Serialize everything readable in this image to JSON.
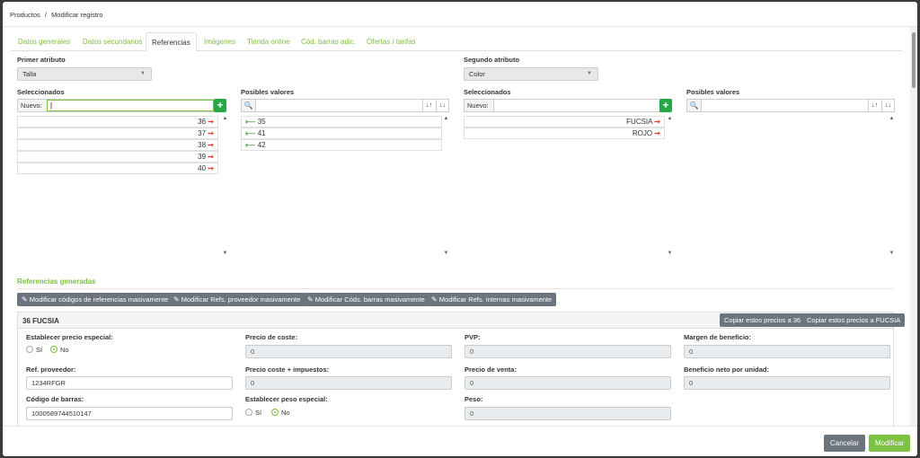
{
  "breadcrumb": {
    "root": "Productos",
    "sep": "/",
    "current": "Modificar registro"
  },
  "tabs": [
    {
      "label": "Datos generales"
    },
    {
      "label": "Datos secundarios"
    },
    {
      "label": "Referencias"
    },
    {
      "label": "Imágenes"
    },
    {
      "label": "Tienda online"
    },
    {
      "label": "Cód. barras adic."
    },
    {
      "label": "Ofertas / tarifas"
    }
  ],
  "attr1": {
    "title": "Primer atributo",
    "value": "Talla",
    "selected_label": "Seleccionados",
    "possible_label": "Posibles valores",
    "new_label": "Nuevo:",
    "new_value": "|",
    "selected": [
      "36",
      "37",
      "38",
      "39",
      "40"
    ],
    "possible": [
      "35",
      "41",
      "42"
    ]
  },
  "attr2": {
    "title": "Segundo atributo",
    "value": "Color",
    "selected_label": "Seleccionados",
    "possible_label": "Posibles valores",
    "new_label": "Nuevo:",
    "selected": [
      "FUCSIA",
      "ROJO"
    ],
    "possible": []
  },
  "generated": {
    "title": "Referencias generadas",
    "buttons": [
      "Modificar códigos de referencias masivamente",
      "Modificar Refs. proveedor masivamente",
      "Modificar Códs. barras masivamente",
      "Modificar Refs. internas masivamente"
    ]
  },
  "ref": {
    "title": "36 FUCSIA",
    "copy_btn1": "Copiar estos precios a 36",
    "copy_btn2": "Copiar estos precios a FUCSIA",
    "special_price_label": "Establecer precio especial:",
    "special_weight_label": "Establecer peso especial:",
    "yes": "Sí",
    "no": "No",
    "supplier_ref_label": "Ref. proveedor:",
    "supplier_ref": "1234RFGR",
    "barcode_label": "Código de barras:",
    "barcode": "1000589744510147",
    "cost_label": "Precio de coste:",
    "cost": "0",
    "cost_tax_label": "Precio coste + impuestos:",
    "cost_tax": "0",
    "pvp_label": "PVP:",
    "pvp": "0",
    "sale_price_label": "Precio de venta:",
    "sale_price": "0",
    "weight_label": "Peso:",
    "weight": "0",
    "margin_label": "Margen de beneficio:",
    "margin": "0",
    "net_profit_label": "Beneficio neto por unidad:",
    "net_profit": "0"
  },
  "footer": {
    "cancel": "Cancelar",
    "submit": "Modificar"
  },
  "colors": {
    "accent": "#7cc142",
    "plus": "#28a745",
    "danger_arrow": "#e53935",
    "grey_btn": "#6c757d"
  }
}
